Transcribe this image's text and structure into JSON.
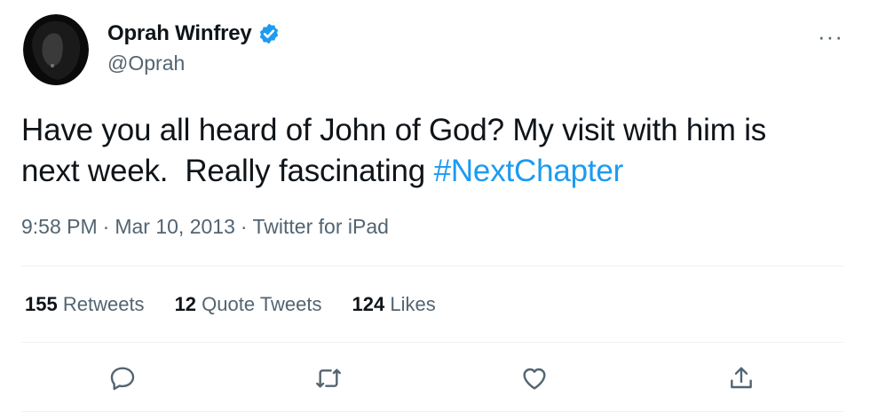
{
  "author": {
    "name": "Oprah Winfrey",
    "handle": "@Oprah",
    "verified": true
  },
  "tweet": {
    "text_line1": "Have you all heard of John of God? My visit with him is",
    "text_line2_prefix": "next week.  Really fascinating ",
    "hashtag": "#NextChapter"
  },
  "meta": {
    "time": "9:58 PM",
    "separator": "·",
    "date": "Mar 10, 2013",
    "source": "Twitter for iPad"
  },
  "stats": {
    "retweets_count": "155",
    "retweets_label": "Retweets",
    "quotes_count": "12",
    "quotes_label": "Quote Tweets",
    "likes_count": "124",
    "likes_label": "Likes"
  },
  "more_menu": "···",
  "icons": [
    "reply-icon",
    "retweet-icon",
    "like-icon",
    "share-icon",
    "verified-badge-icon",
    "more-icon"
  ],
  "colors": {
    "accent": "#1d9bf0",
    "text": "#0f1419",
    "secondary": "#536471",
    "divider": "#eff3f4"
  }
}
